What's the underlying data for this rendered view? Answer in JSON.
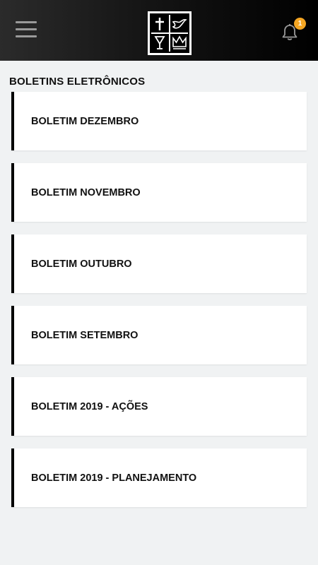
{
  "header": {
    "menu_icon": "hamburger-menu-icon",
    "logo_icon": "church-logo-icon",
    "notification_icon": "bell-icon",
    "notification_count": "1",
    "badge_color": "#f5a623"
  },
  "section": {
    "title": "BOLETINS ELETRÔNICOS"
  },
  "bulletins": [
    {
      "label": "BOLETIM DEZEMBRO"
    },
    {
      "label": "BOLETIM NOVEMBRO"
    },
    {
      "label": "BOLETIM OUTUBRO"
    },
    {
      "label": "BOLETIM SETEMBRO"
    },
    {
      "label": "BOLETIM 2019 - AÇÕES"
    },
    {
      "label": "BOLETIM 2019 - PLANEJAMENTO"
    }
  ]
}
